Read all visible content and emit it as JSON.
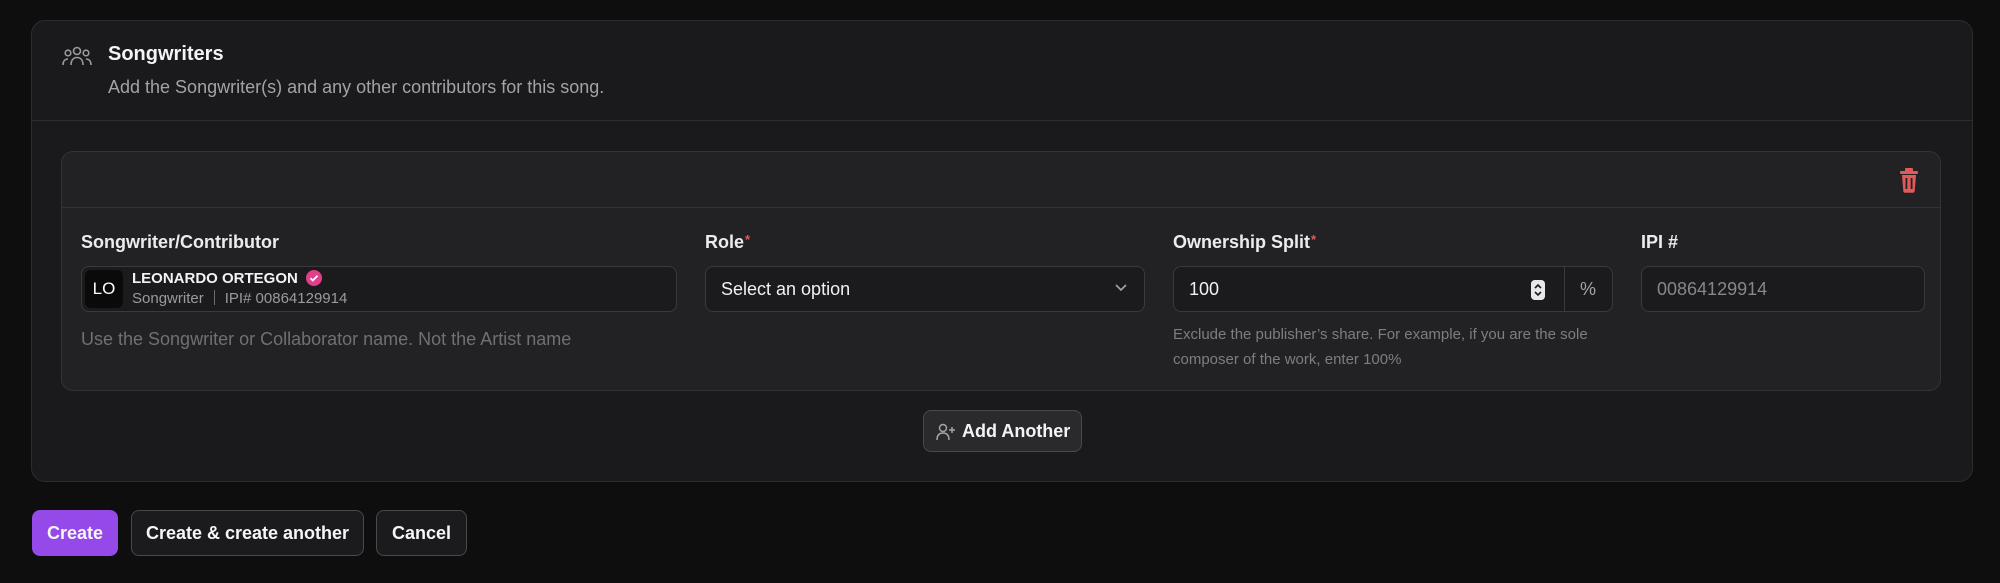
{
  "section": {
    "icon": "users-icon",
    "title": "Songwriters",
    "description": "Add the Songwriter(s) and any other contributors for this song."
  },
  "card": {
    "delete_icon": "trash-icon",
    "songwriter": {
      "label": "Songwriter/Contributor",
      "avatar_initials": "LO",
      "name": "LEONARDO ORTEGON",
      "verified_icon": "verified-check-icon",
      "role": "Songwriter",
      "ipi": "IPI# 00864129914",
      "hint": "Use the Songwriter or Collaborator name. Not the Artist name"
    },
    "role": {
      "label": "Role",
      "required_mark": "*",
      "placeholder": "Select an option",
      "icon": "chevron-down-icon"
    },
    "ownership": {
      "label": "Ownership Split",
      "required_mark": "*",
      "value": "100",
      "suffix": "%",
      "hint_line1": "Exclude the publisher’s share. For example, if you are the sole",
      "hint_line2": "composer of the work, enter 100%"
    },
    "ipi": {
      "label": "IPI #",
      "value": "00864129914"
    }
  },
  "add_another": {
    "icon": "user-plus-icon",
    "label": "Add Another"
  },
  "actions": {
    "create": "Create",
    "create_another": "Create & create another",
    "cancel": "Cancel"
  },
  "colors": {
    "accent": "#9549e8",
    "danger": "#e05a5a",
    "verified": "#e0408a"
  }
}
